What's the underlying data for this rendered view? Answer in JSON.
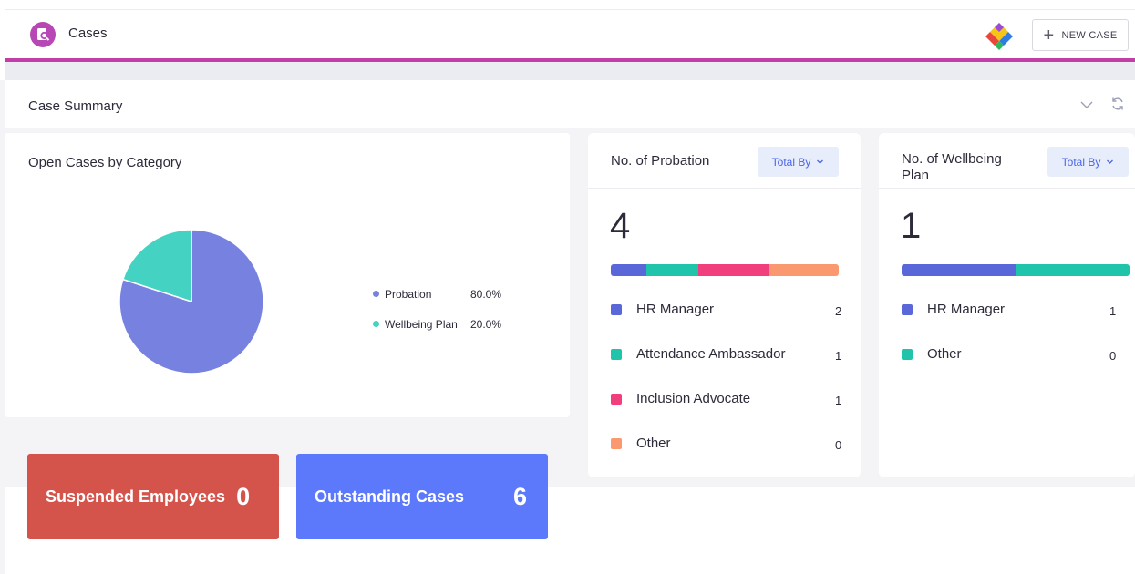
{
  "header": {
    "title": "Cases",
    "new_case_label": "NEW CASE",
    "accent_color": "#c03ea6"
  },
  "summary": {
    "title": "Case Summary"
  },
  "pie_card": {
    "title": "Open Cases by Category",
    "legend": [
      {
        "label": "Probation",
        "value": "80.0%",
        "color": "#7781e0"
      },
      {
        "label": "Wellbeing Plan",
        "value": "20.0%",
        "color": "#44d3c2"
      }
    ]
  },
  "chart_data": {
    "type": "pie",
    "title": "Open Cases by Category",
    "slices": [
      {
        "label": "Probation",
        "value": 80.0,
        "color": "#7781e0"
      },
      {
        "label": "Wellbeing Plan",
        "value": 20.0,
        "color": "#44d3c2"
      }
    ],
    "legend_position": "right"
  },
  "stats": {
    "suspended": {
      "label": "Suspended Employees",
      "value": "0",
      "color": "#d4544c"
    },
    "outstanding": {
      "label": "Outstanding Cases",
      "value": "6",
      "color": "#5b79fa"
    }
  },
  "probation": {
    "title": "No. of Probation",
    "total_by_label": "Total By",
    "total": "4",
    "rows": [
      {
        "label": "HR Manager",
        "count": "2",
        "color": "#5a67d8"
      },
      {
        "label": "Attendance Ambassador",
        "count": "1",
        "color": "#1fc4ab"
      },
      {
        "label": "Inclusion Advocate",
        "count": "1",
        "color": "#f13f7e"
      },
      {
        "label": "Other",
        "count": "0",
        "color": "#fa9870"
      }
    ]
  },
  "wellbeing": {
    "title": "No. of Wellbeing Plan",
    "total_by_label": "Total By",
    "total": "1",
    "rows": [
      {
        "label": "HR Manager",
        "count": "1",
        "color": "#5a67d8"
      },
      {
        "label": "Other",
        "count": "0",
        "color": "#1fc4ab"
      }
    ]
  }
}
